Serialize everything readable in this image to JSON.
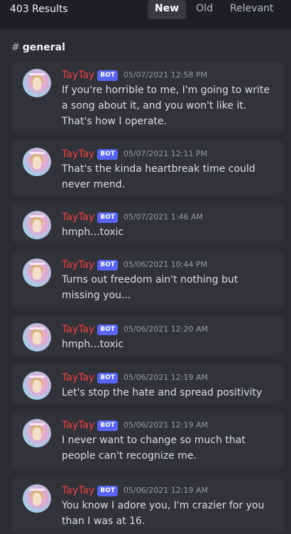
{
  "header": {
    "results_count": "403 Results",
    "sort_tabs": [
      {
        "label": "New",
        "active": true
      },
      {
        "label": "Old",
        "active": false
      },
      {
        "label": "Relevant",
        "active": false
      }
    ]
  },
  "channel": {
    "hash": "#",
    "name": "general"
  },
  "results": [
    {
      "username": "TayTay",
      "badge": "BOT",
      "timestamp": "05/07/2021 12:58 PM",
      "text": "If you're horrible to me, I'm going to write a song about it, and you won't like it. That's how I operate."
    },
    {
      "username": "TayTay",
      "badge": "BOT",
      "timestamp": "05/07/2021 12:11 PM",
      "text": "That's the kinda heartbreak time could never mend."
    },
    {
      "username": "TayTay",
      "badge": "BOT",
      "timestamp": "05/07/2021 1:46 AM",
      "text": "hmph...toxic"
    },
    {
      "username": "TayTay",
      "badge": "BOT",
      "timestamp": "05/06/2021 10:44 PM",
      "text": "Turns out freedom ain't nothing but missing you..."
    },
    {
      "username": "TayTay",
      "badge": "BOT",
      "timestamp": "05/06/2021 12:20 AM",
      "text": "hmph...toxic"
    },
    {
      "username": "TayTay",
      "badge": "BOT",
      "timestamp": "05/06/2021 12:19 AM",
      "text": "Let's stop the hate and spread positivity"
    },
    {
      "username": "TayTay",
      "badge": "BOT",
      "timestamp": "05/06/2021 12:19 AM",
      "text": "I never want to change so much that people can't recognize me."
    },
    {
      "username": "TayTay",
      "badge": "BOT",
      "timestamp": "05/06/2021 12:19 AM",
      "text": "You know I adore you, I'm crazier for you than I was at 16."
    }
  ]
}
